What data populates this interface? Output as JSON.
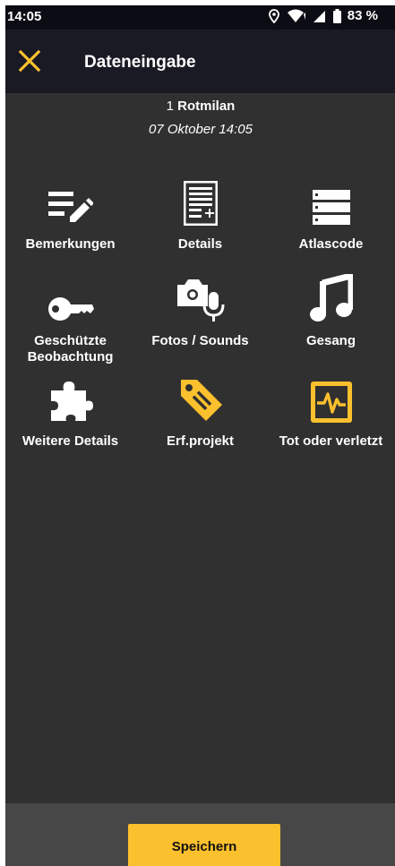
{
  "status_bar": {
    "time": "14:05",
    "battery": "83 %"
  },
  "app_bar": {
    "title": "Dateneingabe",
    "close_icon": "close-icon"
  },
  "observation": {
    "count": "1",
    "species": "Rotmilan",
    "datetime": "07 Oktober 14:05"
  },
  "tiles": [
    {
      "label": "Bemerkungen",
      "icon": "edit-notes-icon"
    },
    {
      "label": "Details",
      "icon": "document-add-icon"
    },
    {
      "label": "Atlascode",
      "icon": "list-icon"
    },
    {
      "label": "Geschützte\nBeobachtung",
      "line1": "Geschützte",
      "line2": "Beobachtung",
      "icon": "key-icon"
    },
    {
      "label": "Fotos / Sounds",
      "icon": "camera-mic-icon"
    },
    {
      "label": "Gesang",
      "icon": "music-note-icon"
    },
    {
      "label": "Weitere Details",
      "icon": "puzzle-icon"
    },
    {
      "label": "Erf.projekt",
      "icon": "tag-icon"
    },
    {
      "label": "Tot oder verletzt",
      "icon": "health-monitor-icon"
    }
  ],
  "footer": {
    "save_label": "Speichern"
  },
  "colors": {
    "accent": "#fbc02d",
    "background": "#303030",
    "appbar": "#1a1a24",
    "bottombar": "#474747"
  }
}
